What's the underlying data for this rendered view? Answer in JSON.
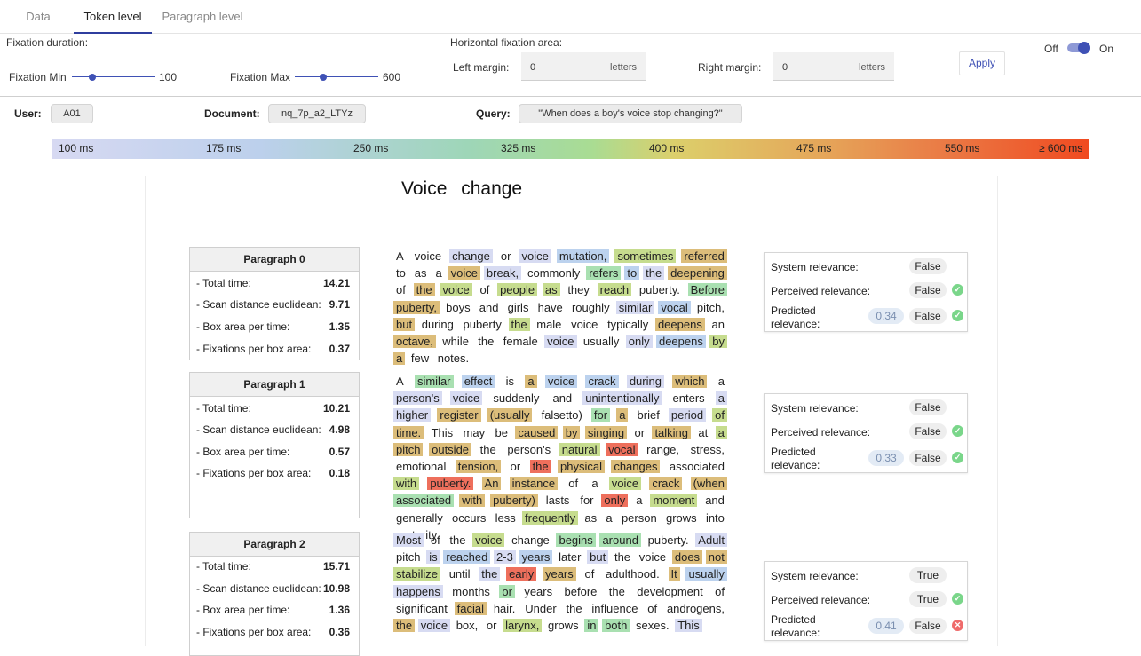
{
  "tabs": [
    {
      "label": "Data"
    },
    {
      "label": "Token level"
    },
    {
      "label": "Paragraph level"
    }
  ],
  "active_tab": "Token level",
  "controls": {
    "fixation_duration_label": "Fixation duration:",
    "fixation_min_label": "Fixation Min",
    "fixation_min_value": "100",
    "fixation_max_label": "Fixation Max",
    "fixation_max_value": "600",
    "horizontal_area_label": "Horizontal fixation area:",
    "left_margin_label": "Left margin:",
    "left_margin_value": "0",
    "right_margin_label": "Right margin:",
    "right_margin_value": "0",
    "unit": "letters",
    "apply_label": "Apply",
    "toggle_off": "Off",
    "toggle_on": "On",
    "toggle_state": true
  },
  "info": {
    "user_label": "User:",
    "user": "A01",
    "document_label": "Document:",
    "document": "nq_7p_a2_LTYz",
    "query_label": "Query:",
    "query": "\"When does a boy's voice stop changing?\""
  },
  "scale_labels": [
    "100 ms",
    "175 ms",
    "250 ms",
    "325 ms",
    "400 ms",
    "475 ms",
    "550 ms",
    "≥ 600 ms"
  ],
  "doc_title": "Voice change",
  "stat_labels": {
    "total": "- Total time:",
    "scan": "- Scan distance euclidean:",
    "box": "- Box area per time:",
    "fix": "- Fixations per box area:"
  },
  "relevance_labels": {
    "system": "System relevance:",
    "perceived": "Perceived relevance:",
    "predicted_1": "Predicted",
    "predicted_2": "relevance:"
  },
  "paragraphs": [
    {
      "title": "Paragraph 0",
      "total": "14.21",
      "scan": "9.71",
      "box": "1.35",
      "fix": "0.37",
      "system": "False",
      "perceived": "False",
      "predicted_score": "0.34",
      "predicted": "False",
      "predicted_correct": true,
      "text": "A voice change or voice mutation, sometimes referred to as a voice break, commonly refers to the deepening of the voice of people as they reach puberty. Before puberty, boys and girls have roughly similar vocal pitch, but during puberty the male voice typically deepens an octave, while the female voice usually only deepens by a few notes."
    },
    {
      "title": "Paragraph 1",
      "total": "10.21",
      "scan": "4.98",
      "box": "0.57",
      "fix": "0.18",
      "system": "False",
      "perceived": "False",
      "predicted_score": "0.33",
      "predicted": "False",
      "predicted_correct": true,
      "text": "A similar effect is a voice crack during which a person's voice suddenly and unintentionally enters a higher register (usually falsetto) for a brief period of time. This may be caused by singing or talking at a pitch outside the person's natural vocal range, stress, emotional tension, or the physical changes associated with puberty. An instance of a voice crack (when associated with puberty) lasts for only a moment and generally occurs less frequently as a person grows into maturity."
    },
    {
      "title": "Paragraph 2",
      "total": "15.71",
      "scan": "10.98",
      "box": "1.36",
      "fix": "0.36",
      "system": "True",
      "perceived": "True",
      "predicted_score": "0.41",
      "predicted": "False",
      "predicted_correct": false,
      "text": "Most of the voice change begins around puberty. Adult pitch is reached 2-3 years later but the voice does not stabilize until the early years of adulthood. It usually happens months or years before the development of significant facial hair. Under the influence of androgens, the voice box, or larynx, grows in both sexes. This"
    }
  ],
  "highlight_colors": {
    "red": "#ee6f5c",
    "orange": "#e39b5e",
    "ochre": "#dcbd7a",
    "yellowgreen": "#c6dc8e",
    "green": "#a9e0b1",
    "blue": "#bcd2ee",
    "lavender": "#d7dbf2"
  },
  "token_levels": [
    [
      0,
      0,
      1,
      0,
      1,
      2,
      4,
      5,
      0,
      0,
      0,
      5,
      1,
      0,
      3,
      2,
      1,
      5,
      0,
      5,
      4,
      0,
      4,
      4,
      0,
      4,
      0,
      3,
      5,
      0,
      0,
      0,
      0,
      0,
      1,
      2,
      0,
      5,
      0,
      0,
      4,
      0,
      0,
      0,
      5,
      0,
      5,
      0
    ],
    [
      0,
      3,
      2,
      0,
      5,
      2,
      2,
      1,
      5,
      0,
      1,
      1,
      0,
      0,
      1,
      0,
      1,
      1,
      5,
      5,
      0,
      3,
      5,
      0,
      1,
      4,
      5,
      0,
      0,
      0,
      5,
      5,
      5,
      0,
      5,
      0,
      4,
      5,
      5,
      0,
      0,
      4,
      6,
      0,
      0,
      0,
      5,
      0,
      6,
      5,
      5,
      0,
      4,
      6,
      5,
      5,
      0,
      0,
      4,
      5,
      5,
      3,
      5,
      5,
      0,
      0,
      6,
      0,
      4,
      0,
      0,
      0,
      0,
      4,
      0,
      0,
      0,
      0,
      0,
      0
    ],
    [
      1,
      0,
      0,
      4,
      0,
      3,
      3,
      0,
      1,
      0,
      1,
      2,
      1,
      2,
      0,
      1,
      0,
      0,
      5,
      5,
      4,
      0,
      1,
      6,
      5,
      0,
      0,
      5,
      2,
      1,
      0,
      3,
      0,
      0,
      0,
      0,
      0,
      0,
      5,
      0,
      0,
      0,
      0,
      0,
      0,
      5
    ]
  ]
}
